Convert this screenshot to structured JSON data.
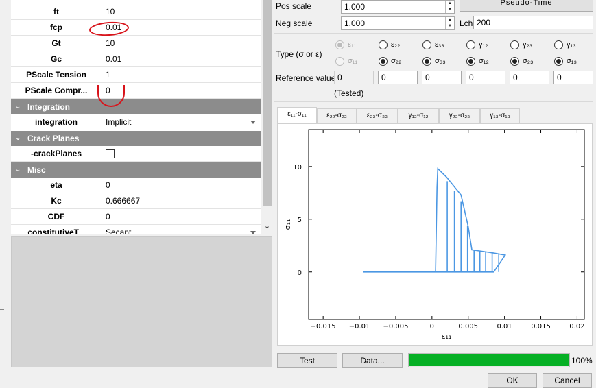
{
  "properties": {
    "rows": [
      {
        "name": "ft",
        "value": "10"
      },
      {
        "name": "fcp",
        "value": "0.01"
      },
      {
        "name": "Gt",
        "value": "10"
      },
      {
        "name": "Gc",
        "value": "0.01"
      },
      {
        "name": "PScale Tension",
        "value": "1"
      },
      {
        "name": "PScale Compr...",
        "value": "0"
      }
    ],
    "integration_category": "Integration",
    "integration": {
      "name": "integration",
      "value": "Implicit"
    },
    "crack_category": "Crack Planes",
    "crack": {
      "name": "-crackPlanes"
    },
    "misc_category": "Misc",
    "misc_rows": [
      {
        "name": "eta",
        "value": "0"
      },
      {
        "name": "Kc",
        "value": "0.666667"
      },
      {
        "name": "CDF",
        "value": "0"
      },
      {
        "name": "constitutiveT...",
        "value": "Secant"
      }
    ]
  },
  "top": {
    "pos_scale_label": "Pos scale",
    "pos_scale": "1.000",
    "neg_scale_label": "Neg scale",
    "neg_scale": "1.000",
    "lch_label": "Lch",
    "lch": "200",
    "pseudo_time_button": "Pseudo-Time"
  },
  "type_section": {
    "label": "Type (σ or ε)",
    "columns": [
      {
        "upper": "ε₁₁",
        "lower": "σ₁₁",
        "upper_checked": true,
        "lower_checked": false,
        "disabled": true
      },
      {
        "upper": "ε₂₂",
        "lower": "σ₂₂",
        "upper_checked": false,
        "lower_checked": true,
        "disabled": false
      },
      {
        "upper": "ε₃₃",
        "lower": "σ₃₃",
        "upper_checked": false,
        "lower_checked": true,
        "disabled": false
      },
      {
        "upper": "γ₁₂",
        "lower": "σ₁₂",
        "upper_checked": false,
        "lower_checked": true,
        "disabled": false
      },
      {
        "upper": "γ₂₃",
        "lower": "σ₂₃",
        "upper_checked": false,
        "lower_checked": true,
        "disabled": false
      },
      {
        "upper": "γ₁₃",
        "lower": "σ₁₃",
        "upper_checked": false,
        "lower_checked": true,
        "disabled": false
      }
    ],
    "reference_label": "Reference value",
    "reference_values": [
      "0",
      "0",
      "0",
      "0",
      "0",
      "0"
    ],
    "tested_label": "(Tested)"
  },
  "tabs": [
    "ε₁₁-σ₁₁",
    "ε₂₂-σ₂₂",
    "ε₃₃-σ₃₃",
    "γ₁₂-σ₁₂",
    "γ₂₃-σ₂₃",
    "γ₁₃-σ₁₃"
  ],
  "chart_data": {
    "type": "line",
    "title": "",
    "xlabel": "ε₁₁",
    "ylabel": "σ₁₁",
    "xlim": [
      -0.017,
      0.021
    ],
    "ylim": [
      -4.5,
      13.5
    ],
    "xticks": [
      -0.015,
      -0.01,
      -0.005,
      0,
      0.005,
      0.01,
      0.015,
      0.02
    ],
    "xtick_labels": [
      "−0.015",
      "−0.01",
      "−0.005",
      "0",
      "0.005",
      "0.01",
      "0.015",
      "0.02"
    ],
    "yticks": [
      0,
      5,
      10
    ],
    "ytick_labels": [
      "0",
      "5",
      "10"
    ],
    "color": "#4b97e3",
    "grid": false,
    "series": [
      {
        "x": [
          -0.0095,
          0.0,
          0.0005,
          0.0007,
          0.0008,
          0.002,
          0.004,
          0.005,
          0.0055,
          0.0075,
          0.0085,
          0.0101,
          0.0085,
          0.0005
        ],
        "y": [
          0.0,
          0.0,
          0.0,
          8.0,
          9.8,
          9.0,
          7.3,
          4.3,
          2.1,
          1.9,
          1.8,
          1.6,
          0.0,
          0.0
        ]
      },
      {
        "x": [
          0.0021,
          0.0021
        ],
        "y": [
          0,
          8.6
        ]
      },
      {
        "x": [
          0.0031,
          0.0031
        ],
        "y": [
          0,
          7.7
        ]
      },
      {
        "x": [
          0.004,
          0.004
        ],
        "y": [
          0,
          6.7
        ]
      },
      {
        "x": [
          0.0049,
          0.0049
        ],
        "y": [
          0,
          4.4
        ]
      },
      {
        "x": [
          0.0058,
          0.0058
        ],
        "y": [
          0,
          2.1
        ]
      },
      {
        "x": [
          0.0066,
          0.0066
        ],
        "y": [
          0,
          2.0
        ]
      },
      {
        "x": [
          0.0074,
          0.0074
        ],
        "y": [
          0,
          1.9
        ]
      },
      {
        "x": [
          0.0083,
          0.0083
        ],
        "y": [
          0,
          1.8
        ]
      },
      {
        "x": [
          0.0092,
          0.0092
        ],
        "y": [
          0,
          1.7
        ]
      }
    ]
  },
  "actions": {
    "test_button": "Test",
    "data_button": "Data...",
    "progress": 100,
    "progress_text": "100%",
    "ok_button": "OK",
    "cancel_button": "Cancel"
  }
}
